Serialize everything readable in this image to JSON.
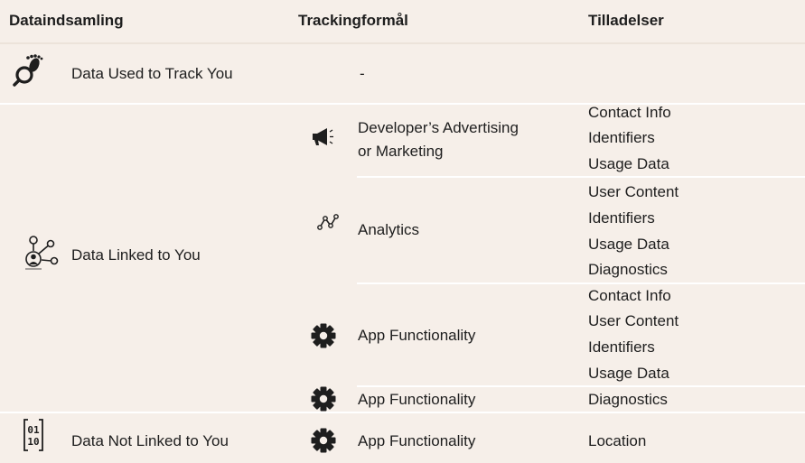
{
  "header": {
    "col1": "Dataindsamling",
    "col2": "Trackingformål",
    "col3": "Tilladelser"
  },
  "rows": {
    "track": {
      "category_icon": "footprint-magnifier-icon",
      "category": "Data Used to Track You",
      "purpose": "-"
    },
    "linked": {
      "category_icon": "linked-person-icon",
      "category": "Data Linked to You",
      "advertising": {
        "icon": "megaphone-icon",
        "purpose_line1": "Developer’s Advertising",
        "purpose_line2": "or Marketing",
        "permissions": [
          "Contact Info",
          "Identifiers",
          "Usage Data"
        ]
      },
      "analytics": {
        "icon": "analytics-line-icon",
        "purpose": "Analytics",
        "permissions": [
          "User Content",
          "Identifiers",
          "Usage Data",
          "Diagnostics"
        ]
      },
      "functionality": {
        "icon": "gear-icon",
        "purpose": "App Functionality",
        "permissions": [
          "Contact Info",
          "User Content",
          "Identifiers",
          "Usage Data"
        ]
      },
      "functionality2": {
        "icon": "gear-icon",
        "purpose": "App Functionality",
        "permissions": [
          "Diagnostics"
        ]
      }
    },
    "not_linked": {
      "category_icon": "binary-icon",
      "category": "Data Not Linked to You",
      "binary_top": "01",
      "binary_bottom": "10",
      "functionality": {
        "icon": "gear-icon",
        "purpose": "App Functionality",
        "permissions": [
          "Location"
        ]
      }
    }
  }
}
